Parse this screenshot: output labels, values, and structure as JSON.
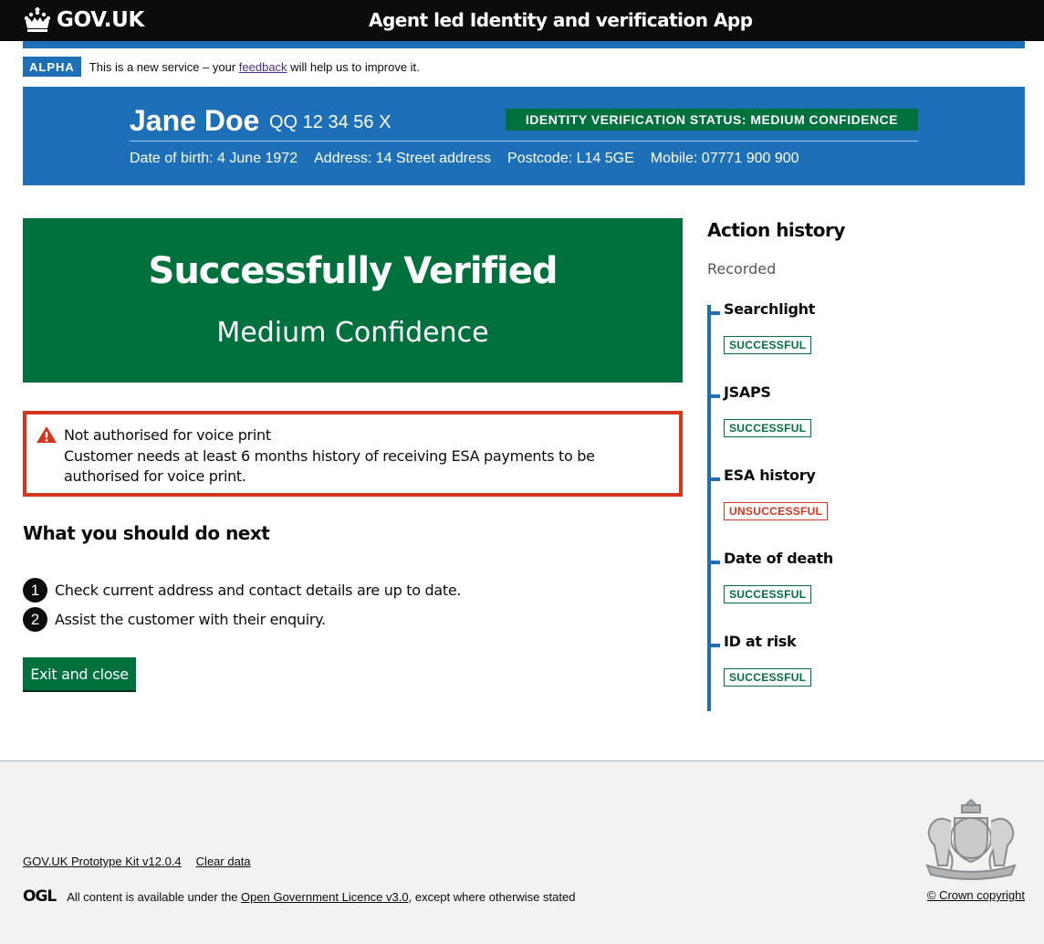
{
  "header": {
    "logo_text": "GOV.UK",
    "service_name": "Agent led Identity and verification App"
  },
  "phase_banner": {
    "tag": "ALPHA",
    "text_before": "This is a new service – your ",
    "link": "feedback",
    "text_after": " will help us to improve it."
  },
  "customer": {
    "name": "Jane Doe",
    "nino": "QQ 12 34 56 X",
    "status": "IDENTITY VERIFICATION STATUS: MEDIUM CONFIDENCE",
    "dob": "Date of birth: 4 June 1972",
    "address": "Address: 14 Street address",
    "postcode": "Postcode: L14 5GE",
    "mobile": "Mobile: 07771 900 900"
  },
  "result_panel": {
    "title": "Successfully Verified",
    "subtitle": "Medium Confidence"
  },
  "warning": {
    "title": "Not authorised for voice print",
    "body": "Customer needs at least 6 months history of receiving ESA payments to be authorised for voice print."
  },
  "next_steps": {
    "heading": "What you should do next",
    "items": [
      {
        "num": "1",
        "text": "Check current address and contact details are up to date."
      },
      {
        "num": "2",
        "text": "Assist the customer with their enquiry."
      }
    ]
  },
  "exit_button": "Exit and close",
  "action_history": {
    "title": "Action history",
    "recorded": "Recorded",
    "items": [
      {
        "name": "Searchlight",
        "status": "SUCCESSFUL"
      },
      {
        "name": "JSAPS",
        "status": "SUCCESSFUL"
      },
      {
        "name": "ESA history",
        "status": "UNSUCCESSFUL"
      },
      {
        "name": "Date of death",
        "status": "SUCCESSFUL"
      },
      {
        "name": "ID at risk",
        "status": "SUCCESSFUL"
      }
    ]
  },
  "footer": {
    "links": [
      "GOV.UK Prototype Kit v12.0.4",
      "Clear data"
    ],
    "ogl_logo": "OGL",
    "licence_before": "All content is available under the ",
    "licence_link": "Open Government Licence v3.0",
    "licence_after": ", except where otherwise stated",
    "copyright": "© Crown copyright"
  },
  "colors": {
    "header_bg": "#0b0c0c",
    "brand_blue": "#1d70b8",
    "success_green": "#00703c",
    "error_red": "#d4351c",
    "footer_bg": "#f3f2f1"
  }
}
